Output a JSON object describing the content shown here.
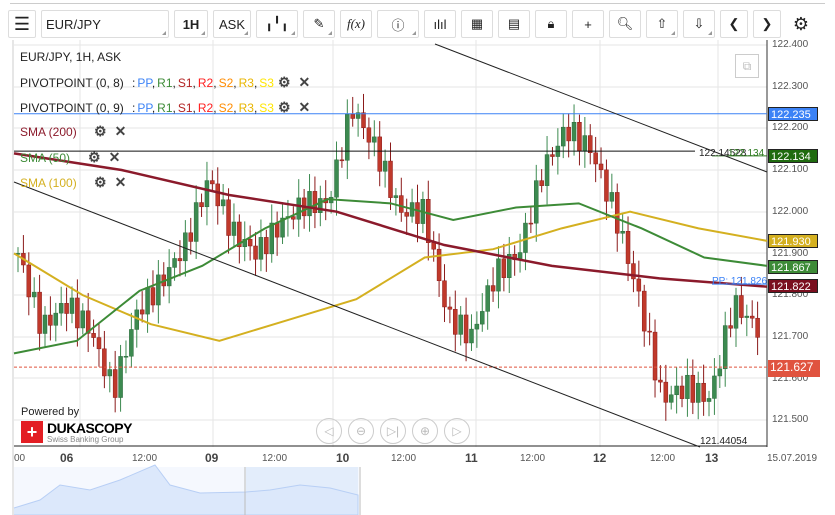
{
  "toolbar": {
    "instrument": "EUR/JPY",
    "period": "1H",
    "side": "ASK",
    "icons": [
      "menu-icon",
      "candles-icon",
      "draw-icon",
      "fx-icon",
      "info-icon",
      "volume-icon",
      "calendar-icon",
      "news-icon",
      "lock-icon",
      "crosshair-icon",
      "zoom-chart-icon",
      "upload-icon",
      "download-icon",
      "prev-icon",
      "next-icon",
      "settings-icon"
    ],
    "fx": "f(x)"
  },
  "legend": {
    "title": "EUR/JPY, 1H, ASK",
    "pivots": [
      {
        "label": "PIVOTPOINT (0, 8)"
      },
      {
        "label": "PIVOTPOINT (0, 9)"
      }
    ],
    "pivot_sep": ":",
    "pivot_levels": [
      {
        "t": "PP",
        "c": "#3b82f6"
      },
      {
        "t": "R1",
        "c": "#3d8b37"
      },
      {
        "t": "S1",
        "c": "#b22222"
      },
      {
        "t": "R2",
        "c": "#ff2020"
      },
      {
        "t": "S2",
        "c": "#ff8c00"
      },
      {
        "t": "R3",
        "c": "#e8b500"
      },
      {
        "t": "S3",
        "c": "#ffe600"
      }
    ],
    "smas": [
      {
        "label": "SMA (200)",
        "color": "#8b1a2b"
      },
      {
        "label": "SMA (50)",
        "color": "#3d8b37"
      },
      {
        "label": "SMA (100)",
        "color": "#d4b020"
      }
    ]
  },
  "chart_data": {
    "type": "candlestick",
    "ylim": [
      121.43,
      122.41
    ],
    "yticks": [
      "122.400",
      "122.300",
      "122.200",
      "122.100",
      "122.000",
      "121.900",
      "121.800",
      "121.700",
      "121.600",
      "121.500"
    ],
    "xticks": [
      {
        "t": "00",
        "b": false
      },
      {
        "t": "06",
        "b": true
      },
      {
        "t": "12:00",
        "b": false
      },
      {
        "t": "09",
        "b": true
      },
      {
        "t": "12:00",
        "b": false
      },
      {
        "t": "10",
        "b": true
      },
      {
        "t": "12:00",
        "b": false
      },
      {
        "t": "11",
        "b": true
      },
      {
        "t": "12:00",
        "b": false
      },
      {
        "t": "12",
        "b": true
      },
      {
        "t": "12:00",
        "b": false
      },
      {
        "t": "13",
        "b": true
      },
      {
        "t": "15.07.2019",
        "b": false
      }
    ],
    "close_path": [
      121.9,
      121.72,
      121.78,
      121.72,
      121.57,
      121.76,
      121.83,
      121.92,
      122.08,
      121.95,
      121.9,
      121.97,
      122.02,
      122.02,
      122.25,
      122.15,
      122.0,
      122.0,
      121.75,
      121.7,
      121.85,
      121.9,
      122.1,
      122.2,
      122.15,
      122.0,
      121.8,
      121.55,
      121.58,
      121.55,
      121.78,
      121.72
    ],
    "sma200": [
      122.14,
      122.1,
      122.04,
      122.0,
      121.92,
      121.87,
      121.84,
      121.82
    ],
    "sma50": [
      121.66,
      121.69,
      121.81,
      121.87,
      121.96,
      122.03,
      122.02,
      121.98,
      122.01,
      122.02,
      121.96,
      121.89,
      121.87
    ],
    "sma100": [
      121.9,
      121.8,
      121.73,
      121.69,
      121.74,
      121.79,
      121.89,
      121.91,
      121.96,
      122.0,
      121.96,
      121.93
    ],
    "price_labels": [
      {
        "v": "122.235",
        "c": "#3b82f6"
      },
      {
        "v": "122.134",
        "c": "#1f6b0f"
      },
      {
        "v": "121.930",
        "c": "#d4b020"
      },
      {
        "v": "121.867",
        "c": "#3d8b37"
      },
      {
        "v": "121.822",
        "c": "#7a0f1f"
      },
      {
        "v": "121.627",
        "c": "#e0533f"
      }
    ],
    "annotations": {
      "hline": "122.14528",
      "r1": "122.134",
      "pp": "PP: 121.826",
      "low": "121.44054"
    }
  },
  "branding": {
    "powered": "Powered by",
    "name": "DUKASCOPY",
    "sub": "Swiss Banking Group"
  }
}
